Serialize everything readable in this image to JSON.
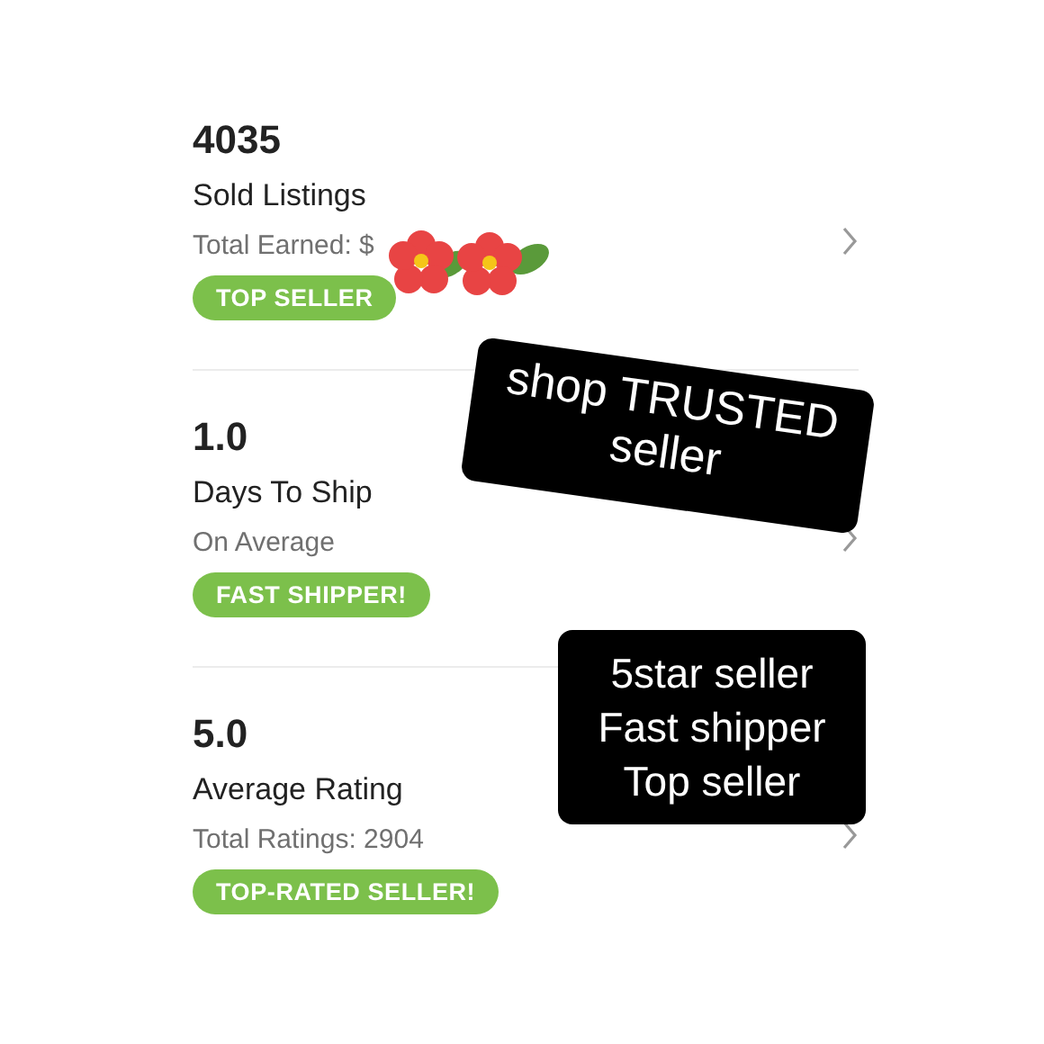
{
  "stats": [
    {
      "value": "4035",
      "label": "Sold Listings",
      "detail": "Total Earned: $",
      "badge": "TOP SELLER"
    },
    {
      "value": "1.0",
      "label": "Days To Ship",
      "detail": "On Average",
      "badge": "FAST SHIPPER!"
    },
    {
      "value": "5.0",
      "label": "Average Rating",
      "detail": "Total Ratings: 2904",
      "badge": "TOP-RATED SELLER!"
    }
  ],
  "stickers": [
    {
      "kind": "flowers"
    },
    {
      "kind": "tilted-note",
      "lines": [
        "shop TRUSTED",
        "seller"
      ]
    },
    {
      "kind": "note",
      "lines": [
        "5star seller",
        "Fast shipper",
        "Top seller"
      ]
    }
  ]
}
